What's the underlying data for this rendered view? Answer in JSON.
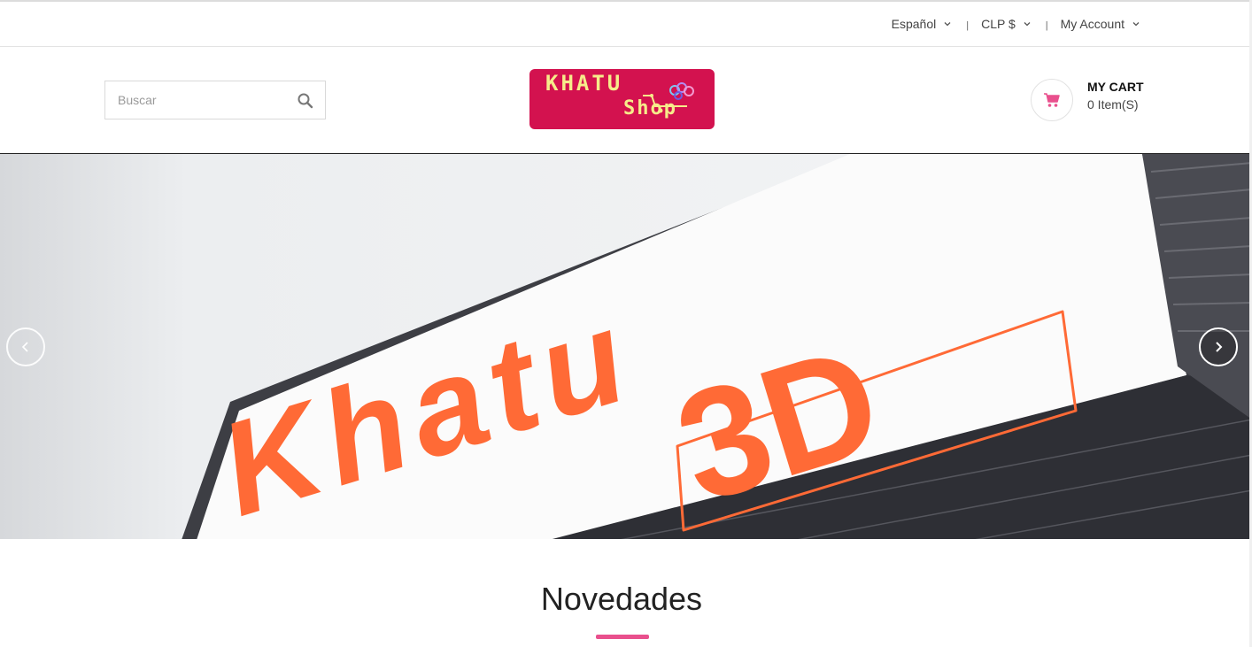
{
  "topbar": {
    "language": "Español",
    "currency": "CLP $",
    "account": "My Account",
    "separator": "|"
  },
  "search": {
    "placeholder": "Buscar",
    "value": ""
  },
  "logo": {
    "line1": "KHATU",
    "line2": "Shop"
  },
  "cart": {
    "title": "MY CART",
    "count": "0 Item(S)"
  },
  "slider": {
    "sign_text": "Khatu",
    "sign_badge": "3D",
    "prev_icon": "chevron-left-icon",
    "next_icon": "chevron-right-icon"
  },
  "section": {
    "title": "Novedades"
  },
  "colors": {
    "brand": "#d3124f",
    "accent": "#e9508d",
    "sign_orange": "#ff6a36"
  }
}
